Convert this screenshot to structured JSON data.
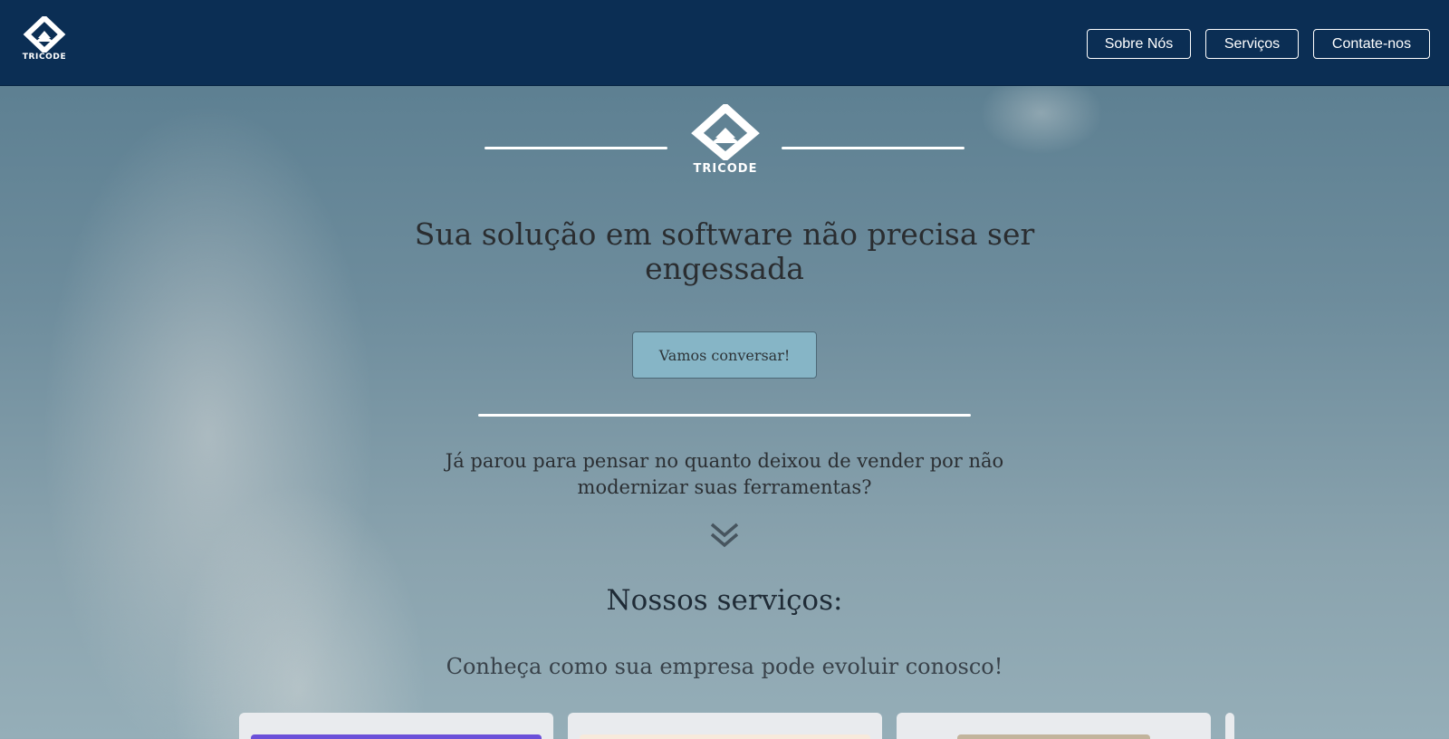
{
  "navbar": {
    "logo_text": "TRICODE",
    "links": [
      {
        "label": "Sobre Nós"
      },
      {
        "label": "Serviços"
      },
      {
        "label": "Contate-nos"
      }
    ]
  },
  "hero": {
    "logo_text": "TRICODE",
    "headline": "Sua solução em software não precisa ser engessada",
    "cta_label": "Vamos conversar!",
    "question": "Já parou para pensar no quanto deixou de vender por não modernizar suas ferramentas?"
  },
  "services": {
    "title": "Nossos serviços:",
    "subtitle": "Conheça como sua empresa pode evoluir conosco!"
  },
  "colors": {
    "navbar": "#0b2e54",
    "cta": "#86b5c6",
    "card_accent_purple": "#6b50d9",
    "card_accent_cream": "#f7eadc",
    "card_accent_tan": "#c2b49c"
  },
  "icons": [
    "tricode-logo-icon",
    "double-chevron-down-icon"
  ]
}
